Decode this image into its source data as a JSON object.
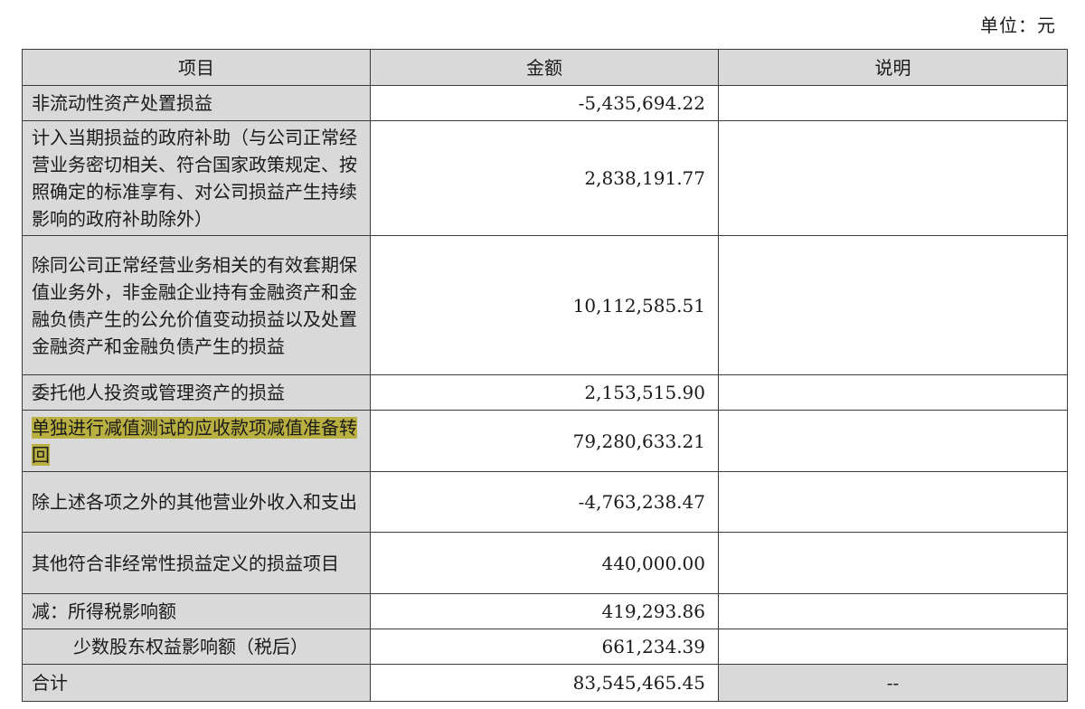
{
  "unit_label": "单位：元",
  "columns": {
    "item": "项目",
    "amount": "金额",
    "note": "说明"
  },
  "rows": [
    {
      "item": "非流动性资产处置损益",
      "amount": "-5,435,694.22",
      "note": ""
    },
    {
      "item": "计入当期损益的政府补助（与公司正常经营业务密切相关、符合国家政策规定、按照确定的标准享有、对公司损益产生持续影响的政府补助除外）",
      "amount": "2,838,191.77",
      "note": ""
    },
    {
      "item": "除同公司正常经营业务相关的有效套期保值业务外，非金融企业持有金融资产和金融负债产生的公允价值变动损益以及处置金融资产和金融负债产生的损益",
      "amount": "10,112,585.51",
      "note": ""
    },
    {
      "item": "委托他人投资或管理资产的损益",
      "amount": "2,153,515.90",
      "note": ""
    },
    {
      "item": "单独进行减值测试的应收款项减值准备转回",
      "amount": "79,280,633.21",
      "note": "",
      "highlighted": true
    },
    {
      "item": "除上述各项之外的其他营业外收入和支出",
      "amount": "-4,763,238.47",
      "note": ""
    },
    {
      "item": "其他符合非经常性损益定义的损益项目",
      "amount": "440,000.00",
      "note": ""
    },
    {
      "item": "减：所得税影响额",
      "amount": "419,293.86",
      "note": ""
    },
    {
      "item": "少数股东权益影响额（税后）",
      "amount": "661,234.39",
      "note": "",
      "indent": true
    },
    {
      "item": "合计",
      "amount": "83,545,465.45",
      "note": "--",
      "total": true
    }
  ],
  "colors": {
    "header_bg": "#d9d9d9",
    "highlight": "#b9b041",
    "border": "#3a3a3a"
  }
}
